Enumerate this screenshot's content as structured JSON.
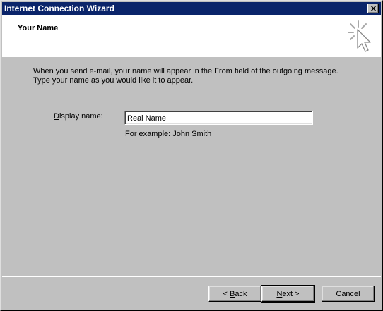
{
  "window": {
    "title": "Internet Connection Wizard"
  },
  "header": {
    "title": "Your Name",
    "icon": "cursor-sparkle-icon"
  },
  "description": {
    "line1": "When you send e-mail, your name will appear in the From field of the outgoing message.",
    "line2": "Type your name as you would like it to appear."
  },
  "form": {
    "display_name_label_accel": "D",
    "display_name_label_rest": "isplay name:",
    "display_name_value": "Real Name",
    "example_text": "For example: John Smith"
  },
  "buttons": {
    "back_prefix": "< ",
    "back_accel": "B",
    "back_rest": "ack",
    "next_accel": "N",
    "next_rest": "ext >",
    "cancel_label": "Cancel"
  },
  "colors": {
    "titlebar": "#0a246a",
    "face": "#c0c0c0",
    "header_bg": "#ffffff"
  }
}
